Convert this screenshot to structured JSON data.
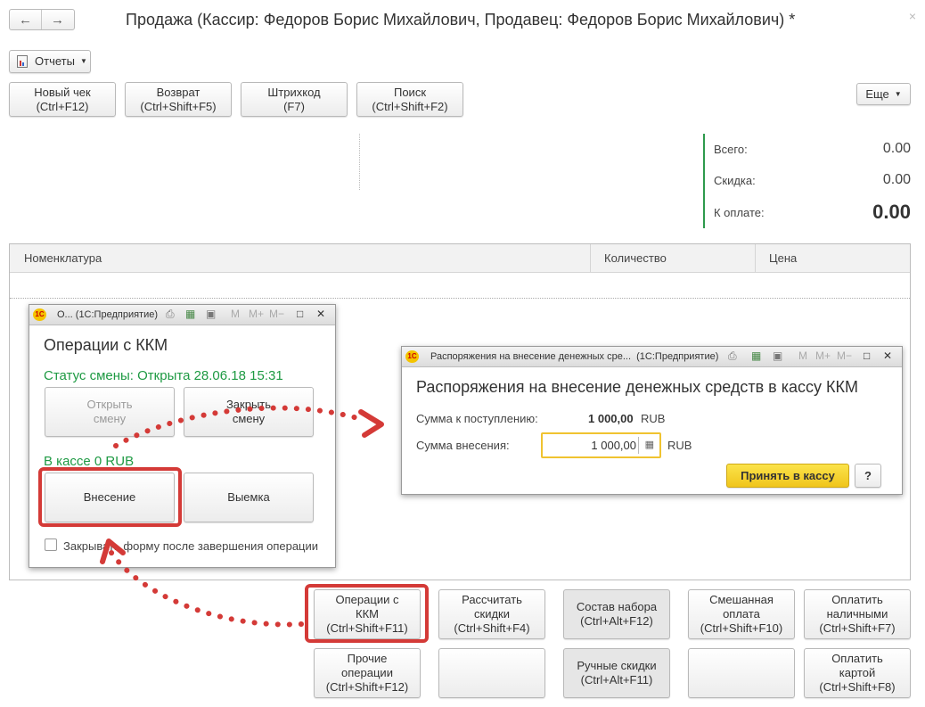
{
  "header": {
    "back_icon": "←",
    "forward_icon": "→",
    "title": "Продажа (Кассир: Федоров Борис Михайлович, Продавец: Федоров Борис Михайлович) *",
    "close_icon": "×"
  },
  "toolbar": {
    "reports_label": "Отчеты",
    "more_label": "Еще",
    "buttons": [
      {
        "line1": "Новый чек",
        "line2": "(Ctrl+F12)"
      },
      {
        "line1": "Возврат",
        "line2": "(Ctrl+Shift+F5)"
      },
      {
        "line1": "Штрихкод",
        "line2": "(F7)"
      },
      {
        "line1": "Поиск",
        "line2": "(Ctrl+Shift+F2)"
      }
    ]
  },
  "totals": {
    "total_label": "Всего:",
    "total_value": "0.00",
    "discount_label": "Скидка:",
    "discount_value": "0.00",
    "to_pay_label": "К оплате:",
    "to_pay_value": "0.00"
  },
  "table": {
    "columns": [
      "Номенклатура",
      "Количество",
      "Цена"
    ]
  },
  "kkm_window": {
    "title": "О... (1С:Предприятие)",
    "heading": "Операции с ККМ",
    "shift_status": "Статус смены: Открыта 28.06.18 15:31",
    "open_shift_1": "Открыть",
    "open_shift_2": "смену",
    "close_shift_1": "Закрыть",
    "close_shift_2": "смену",
    "cash_in_drawer": "В кассе 0 RUB",
    "deposit_label": "Внесение",
    "withdraw_label": "Выемка",
    "close_form_label": "Закрывать форму после завершения операции"
  },
  "deposit_window": {
    "title": "Распоряжения на внесение денежных сре...  (1С:Предприятие)",
    "heading": "Распоряжения на внесение денежных средств в кассу ККМ",
    "receipt_label": "Сумма к поступлению:",
    "receipt_value": "1 000,00",
    "receipt_currency": "RUB",
    "deposit_label": "Сумма внесения:",
    "deposit_value": "1 000,00",
    "deposit_currency": "RUB",
    "accept_label": "Принять в кассу",
    "help_label": "?"
  },
  "bottom_buttons": [
    {
      "line1": "Операции с",
      "line2": "ККМ",
      "line3": "(Ctrl+Shift+F11)"
    },
    {
      "line1": "Рассчитать",
      "line2": "скидки",
      "line3": "(Ctrl+Shift+F4)"
    },
    {
      "line1": "Состав набора",
      "line2": "(Ctrl+Alt+F12)"
    },
    {
      "line1": "Смешанная",
      "line2": "оплата",
      "line3": "(Ctrl+Shift+F10)"
    },
    {
      "line1": "Оплатить",
      "line2": "наличными",
      "line3": "(Ctrl+Shift+F7)"
    },
    {
      "line1": "Прочие",
      "line2": "операции",
      "line3": "(Ctrl+Shift+F12)"
    },
    {
      "line1": "Ручные скидки",
      "line2": "(Ctrl+Alt+F11)"
    },
    {
      "line1": "Оплатить",
      "line2": "картой",
      "line3": "(Ctrl+Shift+F8)"
    }
  ],
  "colors": {
    "accent_yellow": "#f5d21f",
    "annotation_red": "#d43a37",
    "status_green": "#1e9a43",
    "totals_bar": "#2e9a4c"
  }
}
